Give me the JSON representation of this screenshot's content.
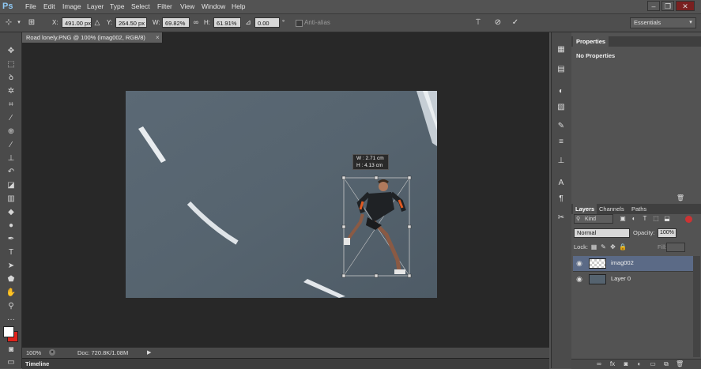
{
  "app": {
    "logo": "Ps"
  },
  "menu": [
    "File",
    "Edit",
    "Image",
    "Layer",
    "Type",
    "Select",
    "Filter",
    "View",
    "Window",
    "Help"
  ],
  "window_buttons": {
    "minimize": "–",
    "restore": "❐",
    "close": "✕"
  },
  "options": {
    "x_label": "X:",
    "x_value": "491.00 px",
    "y_label": "Y:",
    "y_value": "264.50 px",
    "w_label": "W:",
    "w_value": "69.82%",
    "h_label": "H:",
    "h_value": "61.91%",
    "angle_value": "0.00",
    "angle_unit": "°",
    "antialias_label": "Anti-alias",
    "workspace": "Essentials"
  },
  "document": {
    "tab_title": "Road lonely.PNG @ 100% (imag002, RGB/8)",
    "tab_close": "×",
    "transform_hud": {
      "w": "W :  2.71 cm",
      "h": "H :  4.13 cm"
    }
  },
  "status": {
    "zoom": "100%",
    "doc": "Doc: 720.8K/1.08M"
  },
  "timeline": {
    "label": "Timeline"
  },
  "properties": {
    "tab": "Properties",
    "message": "No Properties"
  },
  "layers_panel": {
    "tabs": [
      "Layers",
      "Channels",
      "Paths"
    ],
    "filter_kind": "Kind",
    "blend_mode": "Normal",
    "opacity_label": "Opacity:",
    "opacity_value": "100%",
    "lock_label": "Lock:",
    "fill_label": "Fill:",
    "layers": [
      {
        "name": "imag002",
        "selected": true
      },
      {
        "name": "Layer 0",
        "selected": false
      }
    ]
  },
  "colors": {
    "accent": "#8fc9f5",
    "selection": "#5b6a86",
    "foreground": "#ffffff",
    "background": "#e0231b"
  }
}
